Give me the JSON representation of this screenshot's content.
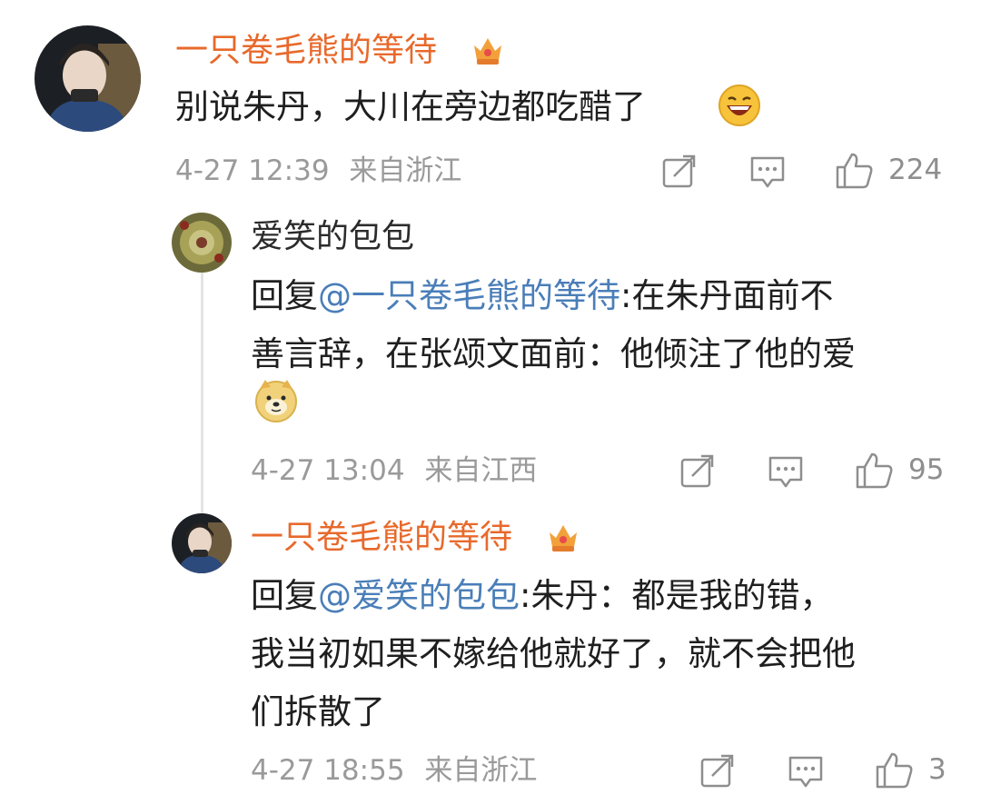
{
  "comment": {
    "author": "一只卷毛熊的等待",
    "badge_icon": "crown-badge-icon",
    "text": "别说朱丹，大川在旁边都吃醋了",
    "emoji": "laughing-face-emoji",
    "date": "4-27 12:39",
    "location": "来自浙江",
    "likes": "224"
  },
  "replies": [
    {
      "author": "爱笑的包包",
      "reply_prefix": "回复",
      "mention": "@一只卷毛熊的等待",
      "text_line1": ":在朱丹面前不",
      "text_line2": "善言辞，在张颂文面前：他倾注了他的爱",
      "emoji": "doge-emoji",
      "date": "4-27 13:04",
      "location": "来自江西",
      "likes": "95"
    },
    {
      "author": "一只卷毛熊的等待",
      "badge_icon": "crown-badge-icon",
      "reply_prefix": "回复",
      "mention": "@爱笑的包包",
      "text_line1": ":朱丹：都是我的错，",
      "text_line2": "我当初如果不嫁给他就好了，就不会把他",
      "text_line3": "们拆散了",
      "date": "4-27 18:55",
      "location": "来自浙江",
      "likes": "3"
    }
  ],
  "icons": {
    "share": "share-icon",
    "comment": "comment-icon",
    "like": "thumbs-up-icon"
  },
  "colors": {
    "author_orange": "#e8692b",
    "mention_blue": "#4a7eb8",
    "meta_gray": "#9a9a9a"
  }
}
